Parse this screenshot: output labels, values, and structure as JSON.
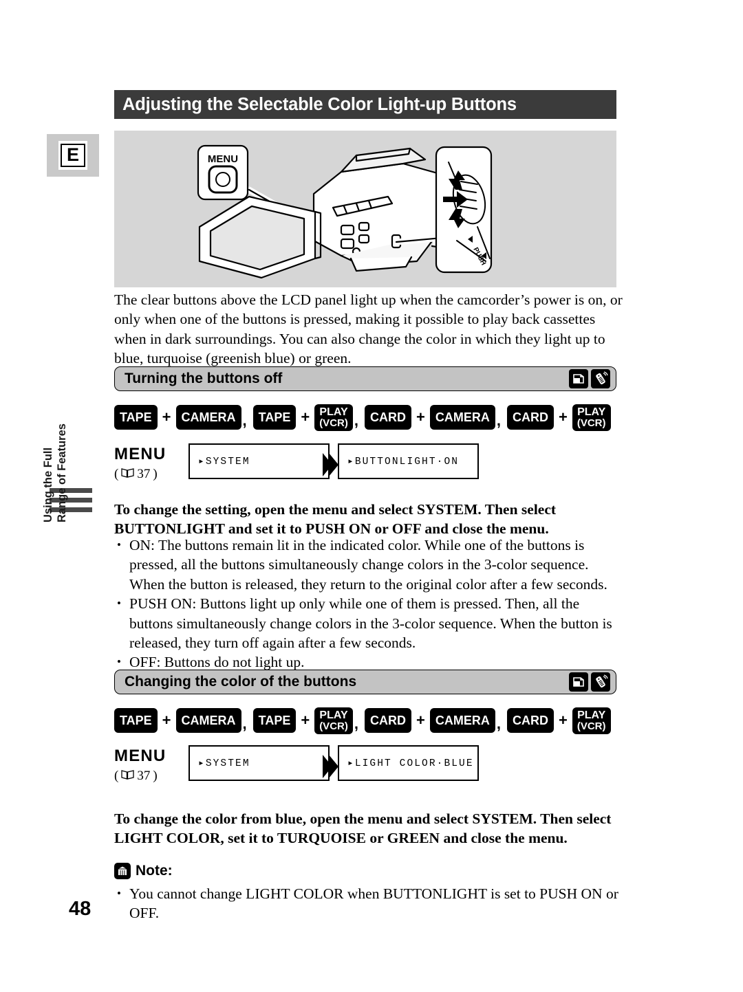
{
  "page": {
    "number": "48",
    "language_tab": "E",
    "sidebar_label_line1": "Using the Full",
    "sidebar_label_line2": "Range of Features"
  },
  "title": "Adjusting the Selectable Color Light-up Buttons",
  "illustration": {
    "menu_callout_label": "MENU",
    "dial_callout_label": "PUSH"
  },
  "intro": "The clear buttons above the LCD panel light up when the camcorder’s power is on, or only when one of the buttons is pressed, making it possible to play back cassettes when in dark surroundings. You can also change the color in which they light up to blue, turquoise (greenish blue) or green.",
  "sections": [
    {
      "heading": "Turning the buttons off",
      "icons": [
        "card-icon",
        "remote-control-icon"
      ],
      "modes": [
        {
          "left": "TAPE",
          "right_line1": "CAMERA",
          "right_line2": ""
        },
        {
          "left": "TAPE",
          "right_line1": "PLAY",
          "right_line2": "(VCR)"
        },
        {
          "left": "CARD",
          "right_line1": "CAMERA",
          "right_line2": ""
        },
        {
          "left": "CARD",
          "right_line1": "PLAY",
          "right_line2": "(VCR)"
        }
      ],
      "menu_word": "MENU",
      "menu_ref": "37",
      "menu_ref_open": "(",
      "menu_ref_close": ")",
      "lcd_first": "▸SYSTEM",
      "lcd_second": "▸BUTTONLIGHT·ON",
      "instruction": "To change the setting, open the menu and select SYSTEM. Then select BUTTONLIGHT and set it to PUSH ON or OFF and close the menu.",
      "bullets": [
        "ON: The buttons remain lit in the indicated color. While one of the buttons is pressed, all the buttons simultaneously change colors in the 3-color sequence. When the button is released, they return to the original color after a few seconds.",
        "PUSH ON: Buttons light up only while one of them is pressed. Then, all the buttons simultaneously change colors in the 3-color sequence. When the button is released, they turn off again after a few seconds.",
        "OFF: Buttons do not light up."
      ]
    },
    {
      "heading": "Changing the color of the buttons",
      "icons": [
        "card-icon",
        "remote-control-icon"
      ],
      "modes": [
        {
          "left": "TAPE",
          "right_line1": "CAMERA",
          "right_line2": ""
        },
        {
          "left": "TAPE",
          "right_line1": "PLAY",
          "right_line2": "(VCR)"
        },
        {
          "left": "CARD",
          "right_line1": "CAMERA",
          "right_line2": ""
        },
        {
          "left": "CARD",
          "right_line1": "PLAY",
          "right_line2": "(VCR)"
        }
      ],
      "menu_word": "MENU",
      "menu_ref": "37",
      "menu_ref_open": "(",
      "menu_ref_close": ")",
      "lcd_first": "▸SYSTEM",
      "lcd_second": "▸LIGHT COLOR·BLUE",
      "instruction": "To change the color from blue, open the menu and select SYSTEM. Then select LIGHT COLOR, set it to TURQUOISE or GREEN and close the menu.",
      "bullets": []
    }
  ],
  "note": {
    "label": "Note:",
    "icon": "note-icon",
    "items": [
      "You cannot change LIGHT COLOR when BUTTONLIGHT is set to PUSH ON or OFF."
    ]
  },
  "separators": {
    "plus": "+",
    "comma": ","
  },
  "colors": {
    "title_bar": "#3b3b3b",
    "illustration_bg": "#d6d6d6",
    "section_header_bg": "#c3c3c3",
    "chip_bg": "#000000",
    "tab_bg": "#c9c9c9"
  }
}
